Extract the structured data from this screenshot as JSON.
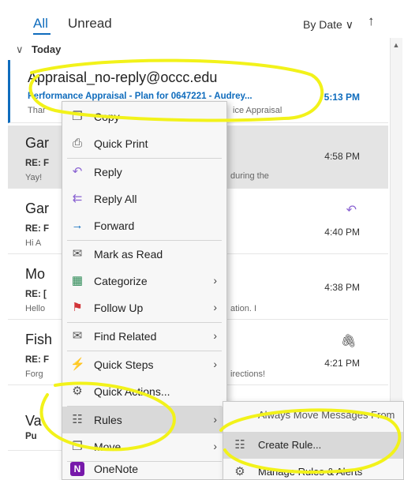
{
  "tabs": {
    "all": "All",
    "unread": "Unread"
  },
  "sort": {
    "label": "By Date",
    "chevron": "∨",
    "direction_icon": "↑"
  },
  "group": {
    "chevron": "∨",
    "label": "Today"
  },
  "messages": [
    {
      "sender": "Appraisal_no-reply@occc.edu",
      "subject": "Performance Appraisal - Plan for 0647221 - Audrey...",
      "preview": "Thar",
      "preview_tail": "ice Appraisal",
      "time": "5:13 PM",
      "state": "active"
    },
    {
      "sender": "Gar",
      "subject": "RE: F",
      "preview": "Yay!",
      "preview_tail": "during the",
      "time": "4:58 PM",
      "state": "selected"
    },
    {
      "sender": "Gar",
      "subject": "RE: F",
      "preview": "Hi A",
      "preview_tail": "",
      "time": "4:40 PM",
      "icon": "reply-icon"
    },
    {
      "sender": "Mo",
      "subject": "RE: [",
      "preview": "Hello",
      "preview_tail": "ation. I",
      "time": "4:38 PM"
    },
    {
      "sender": "Fish",
      "subject": "RE: F",
      "preview": "Forg",
      "preview_tail": "irections!",
      "time": "4:21 PM",
      "icon": "paperclip-icon"
    },
    {
      "sender": "Va",
      "subject": "Pu",
      "preview": "",
      "preview_tail": "",
      "time": ""
    }
  ],
  "context_menu": {
    "items": [
      {
        "label": "Copy",
        "icon": "copy-icon",
        "glyph": "❐",
        "arrow": false
      },
      {
        "label": "Quick Print",
        "icon": "print-icon",
        "glyph": "⎙",
        "arrow": false
      },
      {
        "label": "Reply",
        "icon": "reply-icon",
        "glyph": "↶",
        "arrow": false
      },
      {
        "label": "Reply All",
        "icon": "reply-all-icon",
        "glyph": "⇇",
        "arrow": false
      },
      {
        "label": "Forward",
        "icon": "forward-icon",
        "glyph": "→",
        "arrow": false
      },
      {
        "label": "Mark as Read",
        "icon": "envelope-open-icon",
        "glyph": "✉",
        "arrow": false
      },
      {
        "label": "Categorize",
        "icon": "categorize-icon",
        "glyph": "▦",
        "arrow": true
      },
      {
        "label": "Follow Up",
        "icon": "flag-icon",
        "glyph": "⚑",
        "arrow": true
      },
      {
        "label": "Find Related",
        "icon": "find-related-icon",
        "glyph": "✉",
        "arrow": true
      },
      {
        "label": "Quick Steps",
        "icon": "lightning-icon",
        "glyph": "⚡",
        "arrow": true
      },
      {
        "label": "Quick Actions...",
        "icon": "quick-actions-icon",
        "glyph": "⚙",
        "arrow": false
      },
      {
        "label": "Rules",
        "icon": "rules-icon",
        "glyph": "☷",
        "arrow": true
      },
      {
        "label": "Move",
        "icon": "move-icon",
        "glyph": "❐",
        "arrow": true
      },
      {
        "label": "OneNote",
        "icon": "onenote-icon",
        "glyph": "N",
        "arrow": false
      }
    ]
  },
  "submenu": {
    "items": [
      {
        "label": "Always Move Messages From",
        "icon": "",
        "glyph": ""
      },
      {
        "label": "Create Rule...",
        "icon": "create-rule-icon",
        "glyph": "☷"
      },
      {
        "label": "Manage Rules & Alerts",
        "icon": "manage-rules-icon",
        "glyph": "⚙"
      }
    ]
  },
  "colors": {
    "accent": "#0f6cbd",
    "annotation": "#f2f21a",
    "flag": "#d13438",
    "onenote": "#7719aa"
  }
}
